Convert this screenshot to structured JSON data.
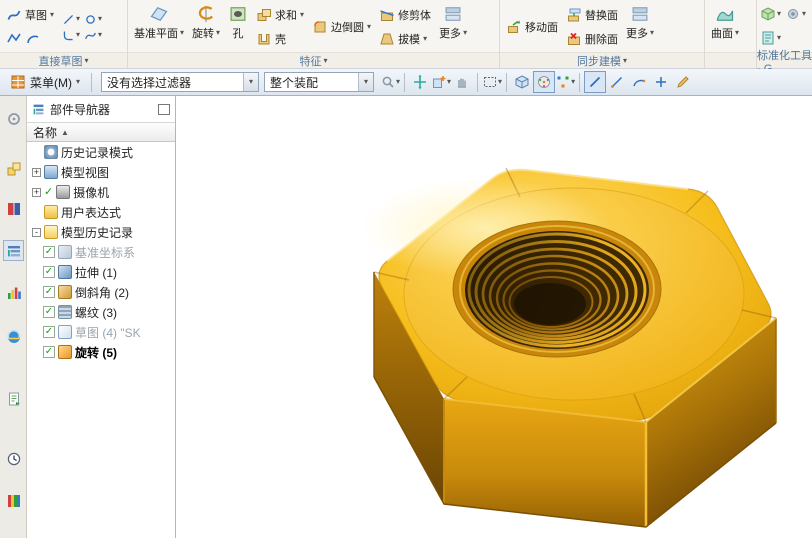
{
  "ui": {
    "arrow": "▾",
    "sort_asc": "▲",
    "plus": "+",
    "minus": "-",
    "check": "✓"
  },
  "ribbon": {
    "sketch": {
      "label": "草图"
    },
    "buttons": {
      "datum_plane": "基准平面",
      "revolve": "旋转",
      "hole": "孔",
      "unite": "求和",
      "shell": "壳",
      "edge_blend": "边倒圆",
      "trim_body": "修剪体",
      "draft": "拔模",
      "more_feature": "更多",
      "move_face": "移动面",
      "replace_face": "替换面",
      "delete_face": "删除面",
      "more_sync": "更多",
      "surface": "曲面"
    },
    "group_labels": {
      "direct_sketch": "直接草图",
      "feature": "特征",
      "sync_modeling": "同步建模",
      "standard_tools": "标准化工具 - G..."
    }
  },
  "toolbar": {
    "menu": "菜单(M)",
    "selection_filter": "没有选择过滤器",
    "assembly_scope": "整个装配"
  },
  "navigator": {
    "title": "部件导航器",
    "name_header": "名称",
    "items": [
      {
        "label": "历史记录模式"
      },
      {
        "label": "模型视图"
      },
      {
        "label": "摄像机"
      },
      {
        "label": "用户表达式"
      },
      {
        "label": "模型历史记录"
      },
      {
        "label": "基准坐标系"
      },
      {
        "label": "拉伸 (1)"
      },
      {
        "label": "倒斜角 (2)"
      },
      {
        "label": "螺纹 (3)"
      },
      {
        "label": "草图 (4) \"SK"
      },
      {
        "label": "旋转 (5)"
      }
    ]
  },
  "colors": {
    "nut_gold": "#F2B30A",
    "nut_highlight": "#FFDE72",
    "nut_shadow": "#6E4603",
    "hole_dark": "#2B1B02",
    "group_label_blue": "#50779C"
  }
}
